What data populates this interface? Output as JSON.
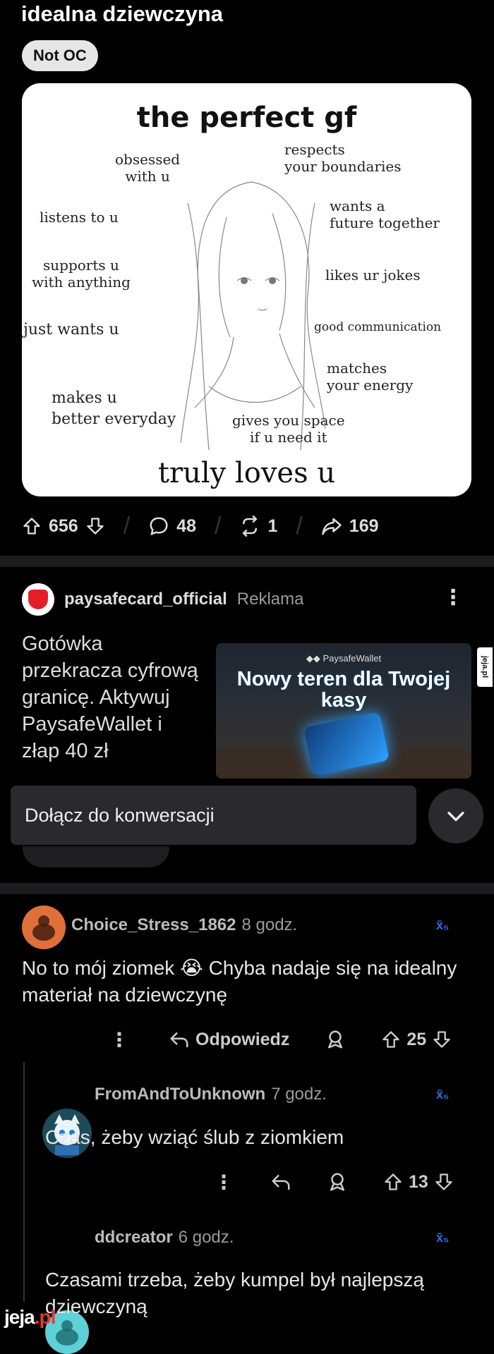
{
  "post": {
    "title": "idealna dziewczyna",
    "flair": "Not OC",
    "image": {
      "title": "the perfect gf",
      "traits": {
        "obsessed": "obsessed\nwith u",
        "respects": "respects\nyour boundaries",
        "listens": "listens to u",
        "future": "wants a\nfuture together",
        "supports": "supports u\nwith anything",
        "jokes": "likes ur jokes",
        "wants": "just wants u",
        "communication": "good communication",
        "energy": "matches\nyour energy",
        "better": "makes u\nbetter everyday",
        "space": "gives you space\nif u need it"
      },
      "footer": "truly loves u"
    },
    "upvotes": "656",
    "comments": "48",
    "crossposts": "1",
    "shares": "169"
  },
  "ad": {
    "advertiser": "paysafecard_official",
    "tag": "Reklama",
    "text": "Gotówka przekracza cyfrową granicę. Aktywuj PaysafeWallet i złap 40 zł",
    "image_brand": "◆◆ PaysafeWallet",
    "image_headline": "Nowy teren dla Twojej kasy",
    "side_watermark": "jeja.pl"
  },
  "join_bar": {
    "label": "Dołącz do konwersacji"
  },
  "comments": [
    {
      "user": "Choice_Stress_1862",
      "time": "8 godz.",
      "text": "No to mój ziomek 😭 Chyba nadaje się na idealny materiał na dziewczynę",
      "reply_label": "Odpowiedz",
      "votes": "25"
    },
    {
      "user": "FromAndToUnknown",
      "time": "7 godz.",
      "text": "Czas, żeby wziąć ślub z ziomkiem",
      "votes": "13"
    },
    {
      "user": "ddcreator",
      "time": "6 godz.",
      "text": "Czasami trzeba, żeby kumpel był najlepszą dziewczyną"
    }
  ],
  "translate_icon_text": "x̄₅",
  "watermark": {
    "main": "jeja",
    "suffix": ".pl"
  },
  "colors": {
    "accent_blue": "#2e6be0",
    "brand_red": "#e41e26",
    "background": "#000000"
  }
}
